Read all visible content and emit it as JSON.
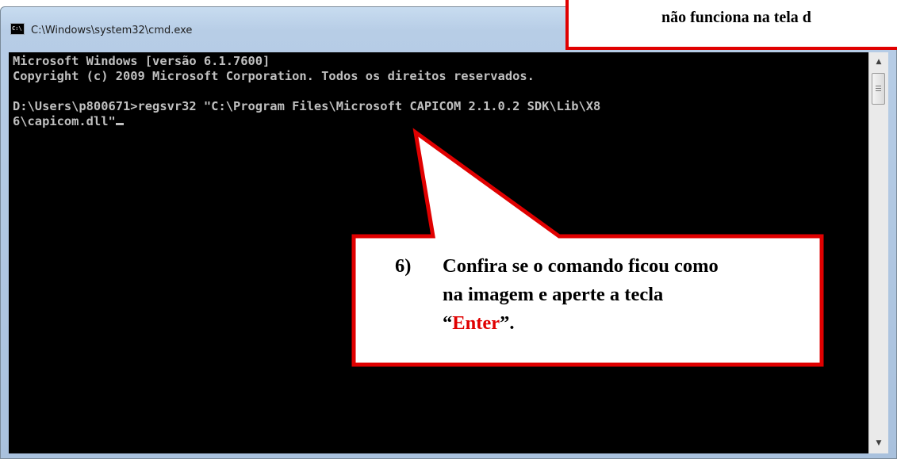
{
  "window": {
    "title": "C:\\Windows\\system32\\cmd.exe",
    "icon": "cmd-icon"
  },
  "console": {
    "lines": [
      "Microsoft Windows [versão 6.1.7600]",
      "Copyright (c) 2009 Microsoft Corporation. Todos os direitos reservados.",
      "",
      "D:\\Users\\p800671>regsvr32 \"C:\\Program Files\\Microsoft CAPICOM 2.1.0.2 SDK\\Lib\\X8",
      "6\\capicom.dll\""
    ],
    "text_color": "#c0c0c0",
    "background": "#000000"
  },
  "callout_top": {
    "text": "não funciona na tela d",
    "border_color": "#e00000"
  },
  "callout_step": {
    "number": "6)",
    "line1": "Confira se o comando ficou como",
    "line2": "na imagem e aperte a tecla",
    "quote_open": "“",
    "key": "Enter",
    "quote_close": "”.",
    "border_color": "#e00000",
    "key_color": "#e00000"
  },
  "scrollbar": {
    "up_icon": "scroll-up-arrow-icon",
    "down_icon": "scroll-down-arrow-icon"
  }
}
